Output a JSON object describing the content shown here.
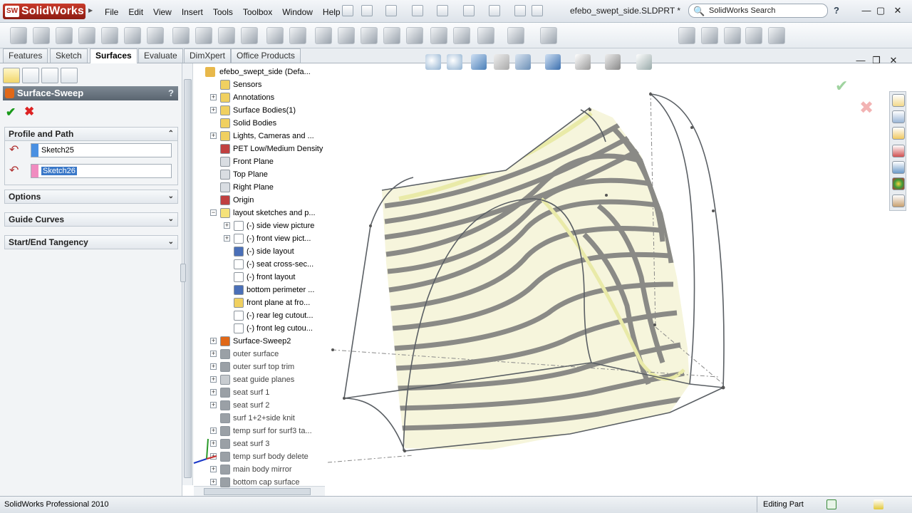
{
  "app": {
    "brand": "SolidWorks",
    "document_title": "efebo_swept_side.SLDPRT *"
  },
  "menu": [
    "File",
    "Edit",
    "View",
    "Insert",
    "Tools",
    "Toolbox",
    "Window",
    "Help"
  ],
  "search": {
    "value": "SolidWorks Search"
  },
  "tabs": [
    {
      "label": "Features"
    },
    {
      "label": "Sketch"
    },
    {
      "label": "Surfaces",
      "active": true
    },
    {
      "label": "Evaluate"
    },
    {
      "label": "DimXpert"
    },
    {
      "label": "Office Products"
    }
  ],
  "property_manager": {
    "title": "Surface-Sweep",
    "help": "?",
    "groups": {
      "profile_and_path": "Profile and Path",
      "options": "Options",
      "guide_curves": "Guide Curves",
      "tangency": "Start/End Tangency"
    },
    "profile": {
      "value": "Sketch25",
      "color": "#4a90e2"
    },
    "path": {
      "value": "Sketch26",
      "color": "#f08cc0"
    }
  },
  "tree": {
    "root": "efebo_swept_side  (Defa...",
    "items": [
      {
        "label": "Sensors"
      },
      {
        "label": "Annotations"
      },
      {
        "label": "Surface Bodies(1)"
      },
      {
        "label": "Solid Bodies"
      },
      {
        "label": "Lights, Cameras and ..."
      },
      {
        "label": "PET Low/Medium Density"
      },
      {
        "label": "Front Plane"
      },
      {
        "label": "Top Plane"
      },
      {
        "label": "Right Plane"
      },
      {
        "label": "Origin"
      },
      {
        "label": "layout sketches and p..."
      },
      {
        "label": "(-) side view picture"
      },
      {
        "label": "(-) front view pict..."
      },
      {
        "label": "(-) side layout"
      },
      {
        "label": "(-) seat cross-sec..."
      },
      {
        "label": "(-) front layout"
      },
      {
        "label": "bottom perimeter ..."
      },
      {
        "label": "front plane at fro..."
      },
      {
        "label": "(-) rear leg cutout..."
      },
      {
        "label": "(-) front leg cutou..."
      },
      {
        "label": "Surface-Sweep2"
      },
      {
        "label": "outer surface"
      },
      {
        "label": "outer surf top trim"
      },
      {
        "label": "seat guide planes"
      },
      {
        "label": "seat surf 1"
      },
      {
        "label": "seat surf 2"
      },
      {
        "label": "surf 1+2+side knit"
      },
      {
        "label": "temp surf for surf3 ta..."
      },
      {
        "label": "seat surf 3"
      },
      {
        "label": "temp surf body delete"
      },
      {
        "label": "main body mirror"
      },
      {
        "label": "bottom cap surface"
      }
    ]
  },
  "status": {
    "app": "SolidWorks Professional 2010",
    "mode": "Editing Part"
  },
  "colors": {
    "accent": "#3a78c8",
    "ok": "#1a9a1a",
    "cancel": "#dd2222"
  }
}
